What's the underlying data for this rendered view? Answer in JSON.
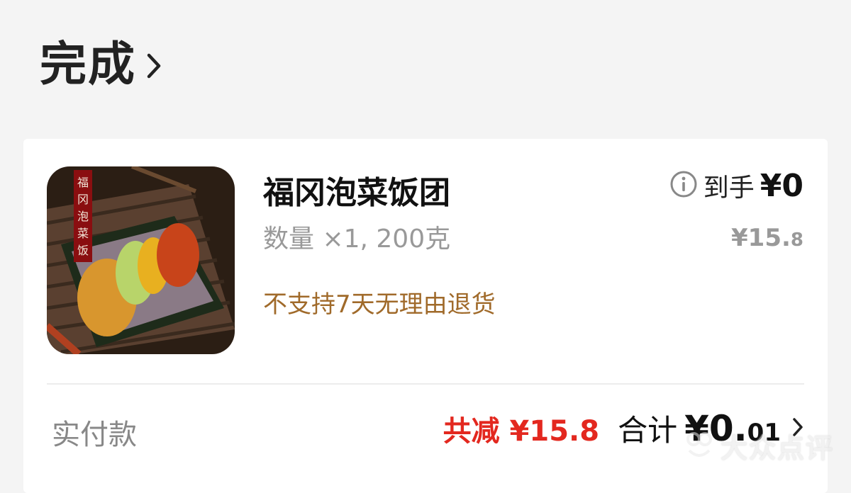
{
  "header": {
    "status_title": "完成"
  },
  "item": {
    "name": "福冈泡菜饭团",
    "received_label": "到手",
    "received_value": "¥0",
    "quantity": "数量 ×1, 200克",
    "original_price_main": "¥15.",
    "original_price_decimal": "8",
    "return_policy": "不支持7天无理由退货",
    "image_caption": "福冈泡菜饭团"
  },
  "summary": {
    "paid_label": "实付款",
    "discount": "共减 ¥15.8",
    "total_label": "合计",
    "total_main": "¥0.",
    "total_decimal": "01"
  },
  "watermark": {
    "text": "大众点评"
  },
  "colors": {
    "discount_red": "#e3281f",
    "policy_brown": "#a06a2a",
    "background": "#f4f4f4"
  }
}
